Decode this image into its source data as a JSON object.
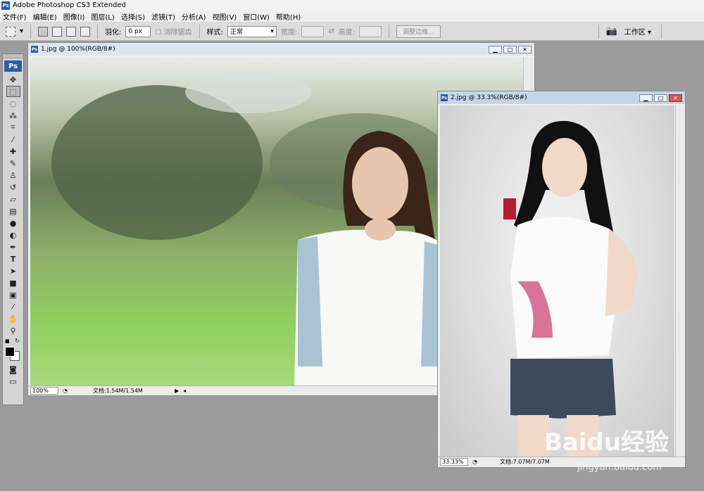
{
  "app": {
    "title": "Adobe Photoshop CS3 Extended",
    "badge": "Ps"
  },
  "menu": [
    "文件(F)",
    "编辑(E)",
    "图像(I)",
    "图层(L)",
    "选择(S)",
    "滤镜(T)",
    "分析(A)",
    "视图(V)",
    "窗口(W)",
    "帮助(H)"
  ],
  "options": {
    "feather_label": "羽化:",
    "feather_value": "0 px",
    "antialias_label": "消除锯齿",
    "style_label": "样式:",
    "style_value": "正常",
    "width_label": "宽度:",
    "height_label": "高度:",
    "refine_edge": "调整边缘...",
    "workspace": "工作区"
  },
  "toolbox": {
    "logo": "Ps"
  },
  "doc1": {
    "title": "1.jpg @ 100%(RGB/8#)",
    "zoom": "100%",
    "file_info": "文档:1.54M/1.54M"
  },
  "doc2": {
    "title": "2.jpg @ 33.3%(RGB/8#)",
    "zoom": "33.33%",
    "file_info": "文档:7.07M/7.07M"
  },
  "watermark": {
    "logo": "Baidu经验",
    "url": "jingyan.baidu.com"
  }
}
